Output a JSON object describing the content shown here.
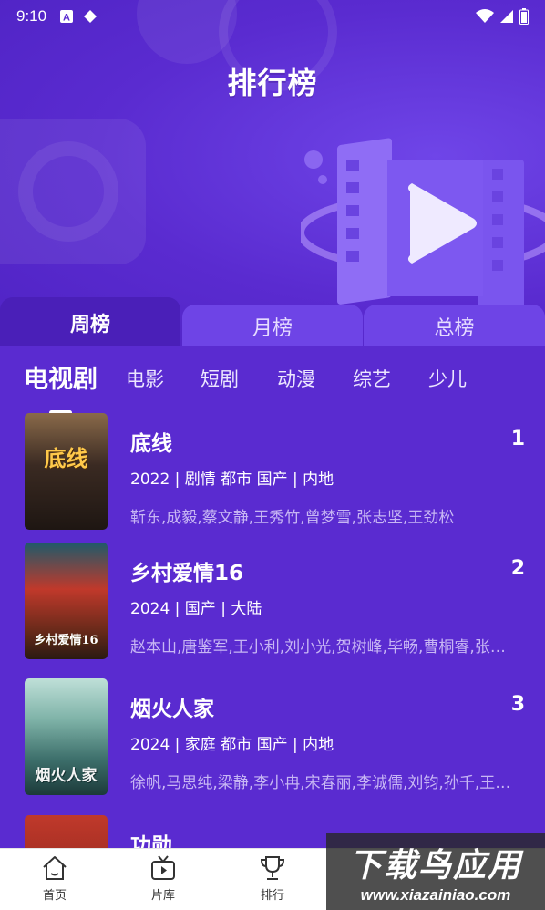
{
  "status_bar": {
    "time": "9:10",
    "icons_left": [
      "a-notification-icon",
      "diamond-notification-icon"
    ],
    "icons_right": [
      "wifi-icon",
      "signal-icon",
      "battery-icon"
    ]
  },
  "header": {
    "title": "排行榜"
  },
  "period_tabs": [
    {
      "label": "周榜",
      "active": true
    },
    {
      "label": "月榜",
      "active": false
    },
    {
      "label": "总榜",
      "active": false
    }
  ],
  "categories": [
    {
      "label": "电视剧",
      "active": true
    },
    {
      "label": "电影",
      "active": false
    },
    {
      "label": "短剧",
      "active": false
    },
    {
      "label": "动漫",
      "active": false
    },
    {
      "label": "综艺",
      "active": false
    },
    {
      "label": "少儿",
      "active": false
    }
  ],
  "items": [
    {
      "title": "底线",
      "rank": "1",
      "meta": "2022 | 剧情 都市 国产 | 内地",
      "cast": "靳东,成毅,蔡文静,王秀竹,曾梦雪,张志坚,王劲松",
      "poster_text": "底线"
    },
    {
      "title": "乡村爱情16",
      "rank": "2",
      "meta": "2024 | 国产 | 大陆",
      "cast": "赵本山,唐鉴军,王小利,刘小光,贺树峰,毕畅,曹桐睿,张…",
      "poster_text": "乡村爱情16"
    },
    {
      "title": "烟火人家",
      "rank": "3",
      "meta": "2024 | 家庭 都市 国产 | 内地",
      "cast": "徐帆,马思纯,梁静,李小冉,宋春丽,李诚儒,刘钧,孙千,王…",
      "poster_text": "烟火人家"
    },
    {
      "title": "功勋",
      "rank": "",
      "meta": "",
      "cast": ""
    }
  ],
  "bottom_nav": [
    {
      "label": "首页",
      "icon": "home-icon",
      "active": false
    },
    {
      "label": "片库",
      "icon": "tv-icon",
      "active": false
    },
    {
      "label": "排行",
      "icon": "trophy-icon",
      "active": true
    }
  ],
  "watermark": {
    "line1": "下载鸟应用",
    "line2": "www.xiazainiao.com"
  },
  "colors": {
    "background": "#5a2bd0",
    "active_tab": "#4a1fb8",
    "inactive_tab": "#6e44e6",
    "cast_text": "#c7b6f4"
  }
}
